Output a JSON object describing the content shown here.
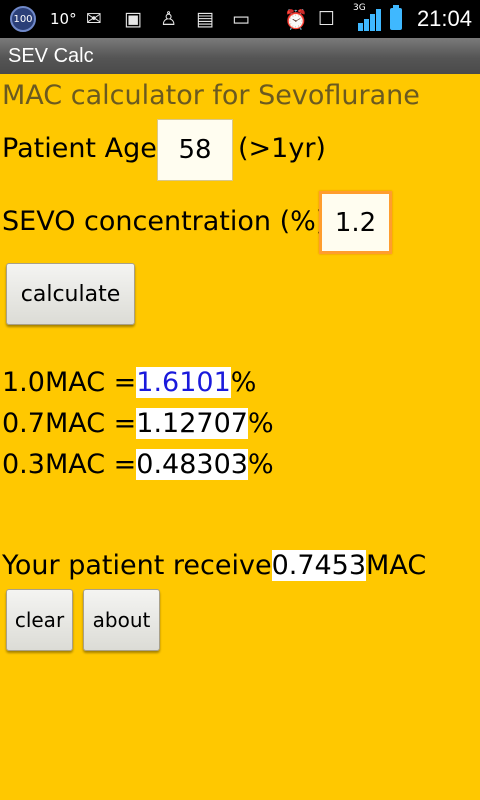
{
  "statusbar": {
    "badge": "100",
    "temperature": "10°",
    "network": "3G",
    "time": "21:04"
  },
  "app": {
    "title": "SEV Calc"
  },
  "heading": "MAC calculator for Sevoflurane",
  "age": {
    "label": "Patient Age",
    "value": "58",
    "hint": "(>1yr)"
  },
  "concentration": {
    "label": "SEVO concentration (%)",
    "value": "1.2"
  },
  "buttons": {
    "calculate": "calculate",
    "clear": "clear",
    "about": "about"
  },
  "results": [
    {
      "label": "1.0MAC =",
      "value": "1.6101",
      "unit": "%"
    },
    {
      "label": "0.7MAC =",
      "value": "1.12707",
      "unit": "%"
    },
    {
      "label": "0.3MAC =",
      "value": "0.48303",
      "unit": "%"
    }
  ],
  "receive": {
    "prefix": "Your patient receive",
    "value": "0.7453",
    "suffix": "MAC"
  },
  "colors": {
    "background": "#ffc800",
    "heading": "#6b5a20",
    "highlight_value": "#1a1adc",
    "focus_border": "#ff9d2e"
  }
}
